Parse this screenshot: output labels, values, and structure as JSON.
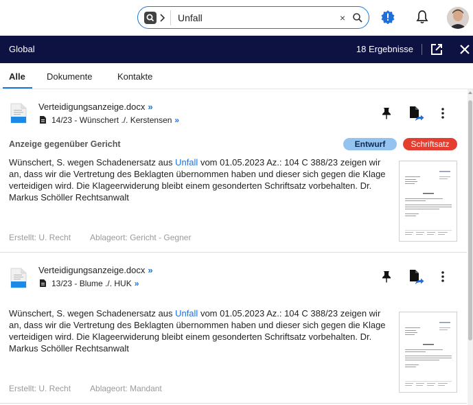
{
  "search": {
    "value": "Unfall",
    "clear_glyph": "×",
    "scope_icon": "search-scope-icon",
    "go_icon": "search-icon"
  },
  "topbar": {
    "alert_icon": "alert-badge-icon",
    "bell_icon": "bell-icon",
    "avatar": "user-avatar"
  },
  "header": {
    "title": "Global",
    "count": "18 Ergebnisse",
    "open_icon": "open-external-icon",
    "close_icon": "close-icon"
  },
  "tabs": [
    {
      "label": "Alle",
      "active": true
    },
    {
      "label": "Dokumente",
      "active": false
    },
    {
      "label": "Kontakte",
      "active": false
    }
  ],
  "results": [
    {
      "title": "Verteidigungsanzeige.docx",
      "arrow": "»",
      "case": "14/23 - Wünschert ./. Kerstensen",
      "case_arrow": "»",
      "subject": "Anzeige gegenüber Gericht",
      "badges": [
        "Entwurf",
        "Schriftsatz"
      ],
      "text_before": "Wünschert, S. wegen Schadenersatz aus ",
      "text_highlight": "Unfall",
      "text_after": " vom 01.05.2023   Az.: 104 C 388/23 zeigen wir an, dass wir die Vertretung des Beklagten übernommen haben und dieser sich gegen die Klage verteidigen wird. Die Klageerwiderung bleibt einem gesonderten Schriftsatz vorbehalten.       Dr. Markus Schöller   Rechtsanwalt",
      "created": "Erstellt:  U. Recht",
      "location": "Ablageort:  Gericht - Gegner"
    },
    {
      "title": "Verteidigungsanzeige.docx",
      "arrow": "»",
      "case": "13/23 - Blume ./. HUK",
      "case_arrow": "»",
      "subject": "",
      "badges": [],
      "text_before": "Wünschert, S. wegen Schadenersatz aus ",
      "text_highlight": "Unfall",
      "text_after": " vom 01.05.2023   Az.: 104 C 388/23 zeigen wir an, dass wir die Vertretung des Beklagten übernommen haben und dieser sich gegen die Klage verteidigen wird. Die Klageerwiderung bleibt einem gesonderten Schriftsatz vorbehalten.       Dr. Markus Schöller   Rechtsanwalt",
      "created": "Erstellt:  U. Recht",
      "location": "Ablageort:  Mandant"
    }
  ],
  "icons": {
    "doc": "word-document-icon",
    "case": "case-file-icon",
    "pin": "pin-icon",
    "send": "send-document-icon",
    "more": "more-vertical-icon"
  },
  "colors": {
    "accent": "#1e6fd9",
    "header_bg": "#0e1242",
    "badge_draft": "#93c3ee",
    "badge_type": "#e53e30"
  }
}
